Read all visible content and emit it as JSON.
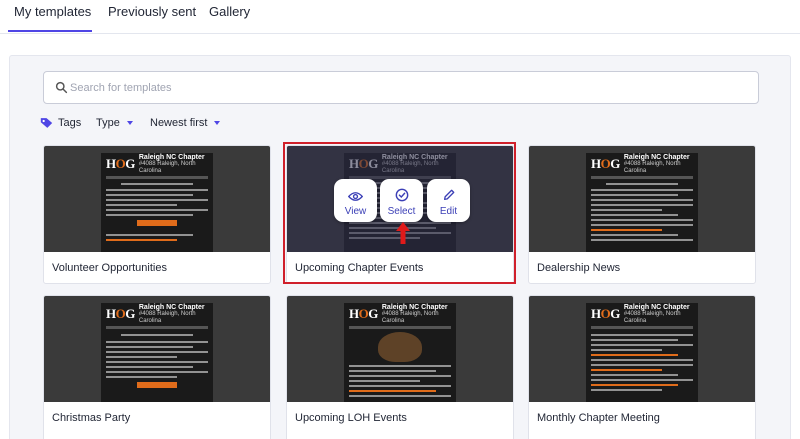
{
  "tabs": [
    {
      "label": "My templates",
      "active": true
    },
    {
      "label": "Previously sent",
      "active": false
    },
    {
      "label": "Gallery",
      "active": false
    }
  ],
  "search": {
    "placeholder": "Search for templates",
    "value": ""
  },
  "filters": {
    "tags_label": "Tags",
    "type_label": "Type",
    "sort_label": "Newest first"
  },
  "templates": [
    {
      "name": "Volunteer Opportunities",
      "selected": false
    },
    {
      "name": "Upcoming Chapter Events",
      "selected": true
    },
    {
      "name": "Dealership News",
      "selected": false
    },
    {
      "name": "Christmas Party",
      "selected": false
    },
    {
      "name": "Upcoming LOH Events",
      "selected": false
    },
    {
      "name": "Monthly Chapter Meeting",
      "selected": false
    }
  ],
  "card_actions": {
    "view": "View",
    "select": "Select",
    "edit": "Edit"
  },
  "colors": {
    "accent": "#4f46e5",
    "highlight": "#d0202b",
    "brand_orange": "#e06c1b"
  },
  "icons": {
    "search": "search-icon",
    "tags": "tag-icon",
    "caret": "caret-down-icon",
    "view": "eye-icon",
    "select": "check-circle-icon",
    "edit": "pencil-icon",
    "arrow": "arrow-up-icon"
  }
}
